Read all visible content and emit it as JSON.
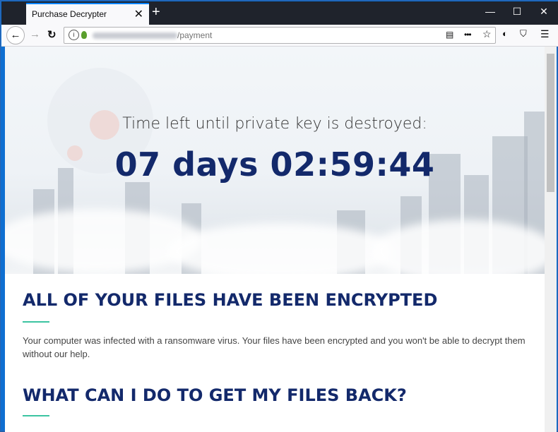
{
  "browser": {
    "tab_title": "Purchase Decrypter",
    "tab_close": "✕",
    "new_tab": "+",
    "url_path": "/payment",
    "window_controls": {
      "minimize": "—",
      "maximize": "☐",
      "close": "✕"
    },
    "nav": {
      "back": "←",
      "forward": "→",
      "reload": "↻"
    },
    "toolbar_icons": [
      "reader-view-icon",
      "more-icon",
      "bookmark-star-icon",
      "shield-icon",
      "tracking-shield-icon",
      "menu-icon"
    ]
  },
  "hero": {
    "subtitle": "Time left until private key is destroyed:",
    "countdown": "07 days 02:59:44"
  },
  "sections": [
    {
      "heading": "ALL OF YOUR FILES HAVE BEEN ENCRYPTED",
      "body": "Your computer was infected with a ransomware virus. Your files have been encrypted and you won't be able to decrypt them without our help."
    },
    {
      "heading": "WHAT CAN I DO TO GET MY FILES BACK?"
    }
  ],
  "colors": {
    "heading": "#13296b",
    "accent_underline": "#3cc4a1",
    "titlebar": "#1f232c",
    "tab_accent": "#0a84ff"
  }
}
